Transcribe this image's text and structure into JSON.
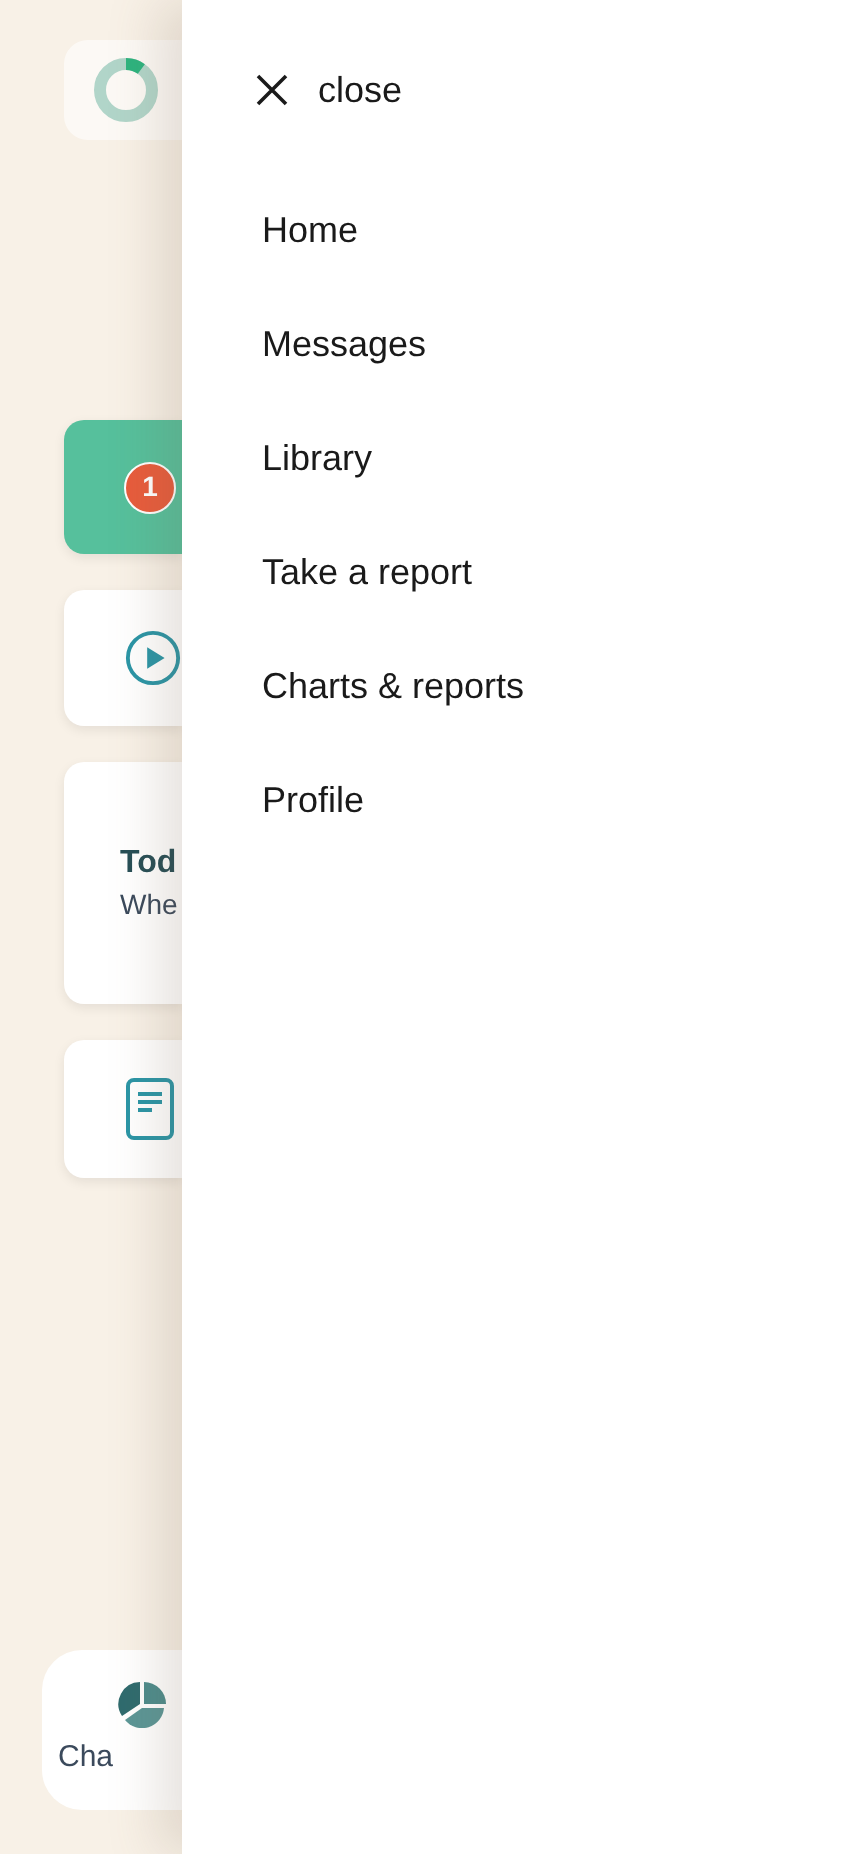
{
  "background": {
    "progress_ring": {
      "level": 0.1
    },
    "cards": [
      {
        "kind": "notification",
        "badge": "1"
      },
      {
        "kind": "video"
      },
      {
        "kind": "text",
        "title": "Tod",
        "subtitle": "Whe"
      },
      {
        "kind": "document"
      }
    ],
    "bottom_nav": {
      "label": "Cha"
    }
  },
  "drawer": {
    "close_label": "close",
    "items": [
      {
        "label": "Home"
      },
      {
        "label": "Messages"
      },
      {
        "label": "Library"
      },
      {
        "label": "Take a report"
      },
      {
        "label": "Charts & reports"
      },
      {
        "label": "Profile"
      }
    ]
  }
}
